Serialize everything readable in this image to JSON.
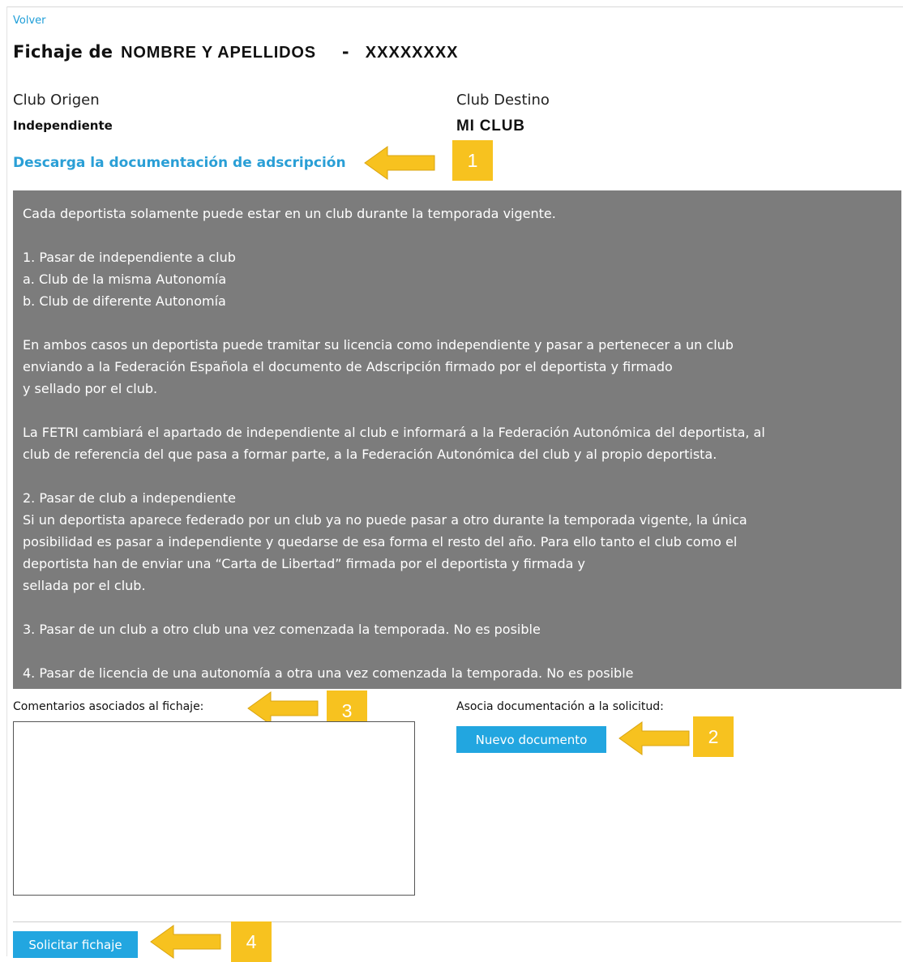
{
  "header": {
    "back_label": "Volver",
    "title_prefix": "Fichaje de",
    "athlete_name": "NOMBRE Y APELLIDOS",
    "separator": "-",
    "athlete_id": "XXXXXXXX"
  },
  "clubs": {
    "origin_label": "Club Origen",
    "origin_value": "Independiente",
    "destination_label": "Club Destino",
    "destination_value": "MI CLUB"
  },
  "download_link": "Descarga la documentación de adscripción",
  "info": {
    "intro": "Cada deportista solamente puede estar en un club durante la temporada vigente.",
    "section1_title": "1. Pasar de independiente a club",
    "section1_a": "a. Club de la misma Autonomía",
    "section1_b": "b. Club de diferente Autonomía",
    "para1_line1": "En ambos casos un deportista puede tramitar su licencia como independiente y pasar a pertenecer a un club",
    "para1_line2": "enviando a la Federación Española el documento de Adscripción firmado por el deportista y firmado",
    "para1_line3": "y sellado por el club.",
    "para2_line1": "La FETRI cambiará el apartado de independiente al club e informará a la Federación Autonómica del deportista, al",
    "para2_line2": "club de referencia del que pasa a formar parte, a la Federación Autonómica del club y al propio deportista.",
    "section2_title": "2. Pasar de club a independiente",
    "section2_line1": "Si un deportista aparece federado por un club ya no puede pasar a otro durante la temporada vigente, la única",
    "section2_line2": "posibilidad es pasar a independiente y quedarse de esa forma el resto del año. Para ello tanto el club como el",
    "section2_line3": "deportista han de enviar una “Carta de Libertad” firmada por el deportista y firmada y",
    "section2_line4": "sellada por el club.",
    "section3": "3. Pasar de un club a otro club una vez comenzada la temporada. No es posible",
    "section4": "4. Pasar de licencia de una autonomía a otra una vez comenzada la temporada. No es posible"
  },
  "comments": {
    "label": "Comentarios asociados al fichaje:",
    "value": ""
  },
  "documents": {
    "label": "Asocia documentación a la solicitud:",
    "new_button": "Nuevo documento"
  },
  "submit_button": "Solicitar fichaje",
  "annotations": {
    "badge_1": "1",
    "badge_2": "2",
    "badge_3": "3",
    "badge_4": "4",
    "color": "#f7c21f"
  },
  "colors": {
    "link": "#2a9fd6",
    "button": "#22a6e0",
    "info_bg": "#7c7c7c"
  }
}
